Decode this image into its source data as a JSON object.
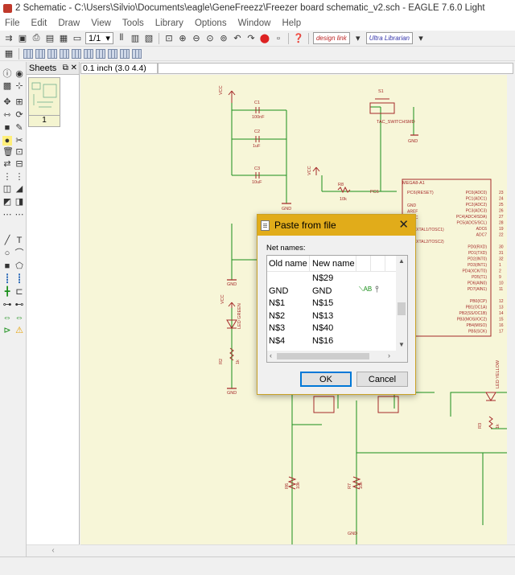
{
  "window": {
    "title": "2 Schematic - C:\\Users\\Silvio\\Documents\\eagle\\GeneFreezz\\Freezer board schematic_v2.sch - EAGLE 7.6.0 Light"
  },
  "menu": [
    "File",
    "Edit",
    "Draw",
    "View",
    "Tools",
    "Library",
    "Options",
    "Window",
    "Help"
  ],
  "toolbar": {
    "sheet_selector": "1/1",
    "brand1": "design link",
    "brand2": "Ultra Librarian"
  },
  "sheets_panel": {
    "title": "Sheets",
    "sheet_number": "1"
  },
  "coord_display": "0.1 inch (3.0 4.4)",
  "dialog": {
    "title": "Paste from file",
    "label": "Net names:",
    "col_old": "Old name",
    "col_new": "New name",
    "rows": [
      {
        "old": "",
        "new": "N$29"
      },
      {
        "old": "GND",
        "new": "GND"
      },
      {
        "old": "N$1",
        "new": "N$15"
      },
      {
        "old": "N$2",
        "new": "N$13"
      },
      {
        "old": "N$3",
        "new": "N$40"
      },
      {
        "old": "N$4",
        "new": "N$16"
      }
    ],
    "ok_label": "OK",
    "cancel_label": "Cancel"
  },
  "schematic": {
    "labels": {
      "vcc1": "VCC",
      "vcc2": "VCC",
      "vcc3": "VCC",
      "c1": "C1",
      "c1v": "100nF",
      "c2": "C2",
      "c2v": "1uF",
      "c3": "C3",
      "c3v": "10uF",
      "s1": "S1",
      "s1v": "TAC_SWITCHSMD",
      "gnd": "GND",
      "r8": "R8",
      "r8v": "10k",
      "pc6": "PC6",
      "mcu": "MEGA8-A1",
      "pc6reset": "PC6(RESET)",
      "pins_left": [
        "GND",
        "AREF",
        "AVCC",
        "",
        "PB6(XTAL1/TOSC1)",
        "",
        "PB7(XTAL2/TOSC2)"
      ],
      "pins_right": [
        "PC0(ADC0)",
        "PC1(ADC1)",
        "PC2(ADC2)",
        "PC3(ADC3)",
        "PC4(ADC4/SDA)",
        "PC5(ADC5/SCL)",
        "ADC6",
        "ADC7",
        "",
        "PD0(RXD)",
        "PD1(TXD)",
        "PD2(INT0)",
        "PD3(INT1)",
        "PD4(XCK/T0)",
        "PD5(T1)",
        "PD6(AIN0)",
        "PD7(AIN1)",
        "",
        "PB0(ICP)",
        "PB1(OC1A)",
        "PB2(SS/OC1B)",
        "PB3(MOSI/OC2)",
        "PB4(MISO)",
        "PB5(SCK)"
      ],
      "pin_nums": [
        "23",
        "24",
        "25",
        "26",
        "27",
        "28",
        "19",
        "22",
        "",
        "30",
        "31",
        "32",
        "1",
        "2",
        "9",
        "10",
        "11",
        "",
        "12",
        "13",
        "14",
        "15",
        "16",
        "17"
      ],
      "led_green": "LED GREEN",
      "led_yellow": "LED YELLOW",
      "r_green": "R2",
      "r_green_v": "1k",
      "r_yellow": "R3",
      "r_yellow_v": "1k",
      "r6": "R6",
      "r6v": "10k",
      "r7": "R7",
      "r7v": "10k"
    }
  },
  "colors": {
    "wire": "#1a8f1a",
    "part": "#a52a2a",
    "canvas": "#f7f6d8",
    "dialog_title": "#e1ac1a"
  }
}
